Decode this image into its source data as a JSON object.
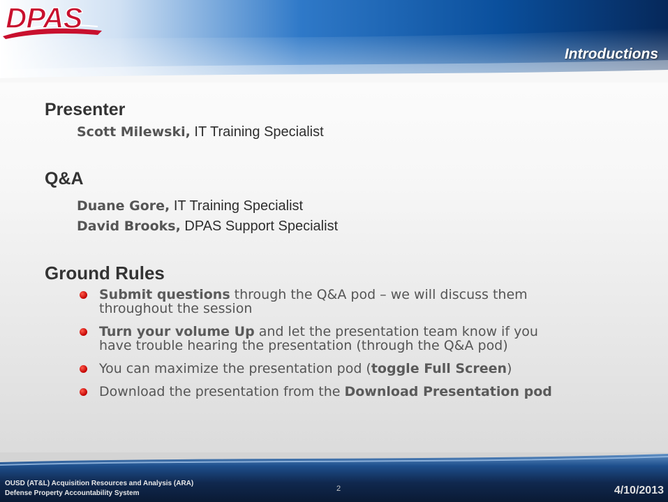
{
  "header": {
    "logo_text": "DPAS",
    "section_title": "Introductions"
  },
  "presenter": {
    "heading": "Presenter",
    "people": [
      {
        "name": "Scott Milewski,",
        "role": "IT Training Specialist"
      }
    ]
  },
  "qa": {
    "heading": "Q&A",
    "people": [
      {
        "name": "Duane Gore,",
        "role": "IT Training Specialist"
      },
      {
        "name": "David Brooks,",
        "role": "DPAS Support Specialist"
      }
    ]
  },
  "ground_rules": {
    "heading": "Ground Rules",
    "items": [
      {
        "bold": "Submit questions",
        "text_after": " through the Q&A pod – we will discuss them",
        "line2": "throughout the session"
      },
      {
        "bold": "Turn your volume Up",
        "text_after": " and let the presentation team know if you",
        "line2": "have trouble hearing the presentation (through the Q&A pod)"
      },
      {
        "text_before": "You can maximize the presentation pod (",
        "bold": "toggle Full Screen",
        "text_after": ")"
      },
      {
        "text_before": "Download the presentation from the ",
        "bold": "Download Presentation pod"
      }
    ]
  },
  "footer": {
    "org_line1": "OUSD (AT&L) Acquisition Resources and Analysis (ARA)",
    "org_line2": "Defense Property Accountability System",
    "page_number": "2",
    "date": "4/10/2013"
  },
  "colors": {
    "header_blue": "#0a4f9c",
    "header_navy": "#06285a",
    "bullet_red": "#c00000",
    "logo_red": "#c8102e",
    "footer_navy": "#0c1e3c"
  }
}
